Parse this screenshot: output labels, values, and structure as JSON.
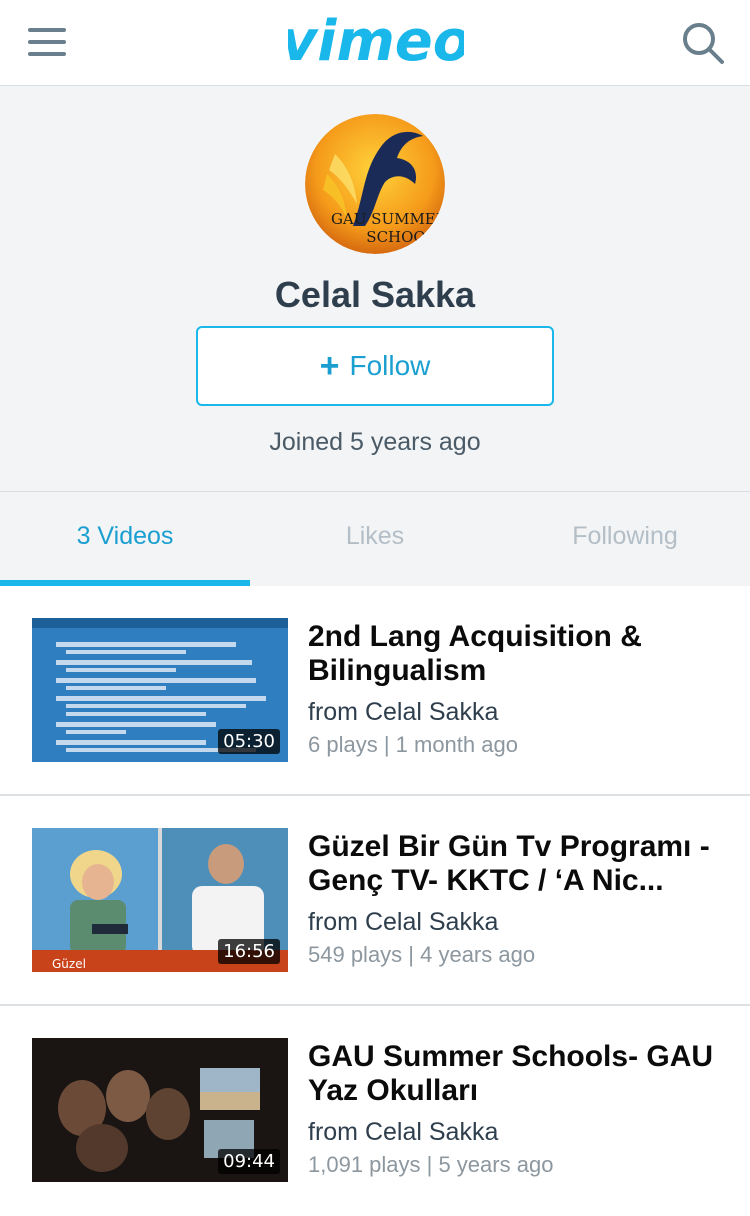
{
  "header": {
    "logo_text": "vimeo",
    "menu_icon": "hamburger-menu-icon",
    "search_icon": "search-icon",
    "brand_color": "#1ab7ea"
  },
  "profile": {
    "avatar_text_line1": "GAU SUMMER",
    "avatar_text_line2": "SCHOOL",
    "name": "Celal Sakka",
    "follow_label": "Follow",
    "joined": "Joined 5 years ago"
  },
  "tabs": [
    {
      "label": "3 Videos",
      "active": true
    },
    {
      "label": "Likes",
      "active": false
    },
    {
      "label": "Following",
      "active": false
    }
  ],
  "videos": [
    {
      "title": "2nd Lang Acquisition & Bilingualism",
      "from": "from Celal Sakka",
      "meta": "6 plays | 1 month ago",
      "duration": "05:30"
    },
    {
      "title": "Güzel Bir Gün Tv Programı - Genç TV- KKTC / ‘A Nic...",
      "from": "from Celal Sakka",
      "meta": "549 plays | 4 years ago",
      "duration": "16:56"
    },
    {
      "title": "GAU Summer Schools- GAU Yaz Okulları",
      "from": "from Celal Sakka",
      "meta": "1,091 plays | 5 years ago",
      "duration": "09:44"
    }
  ]
}
